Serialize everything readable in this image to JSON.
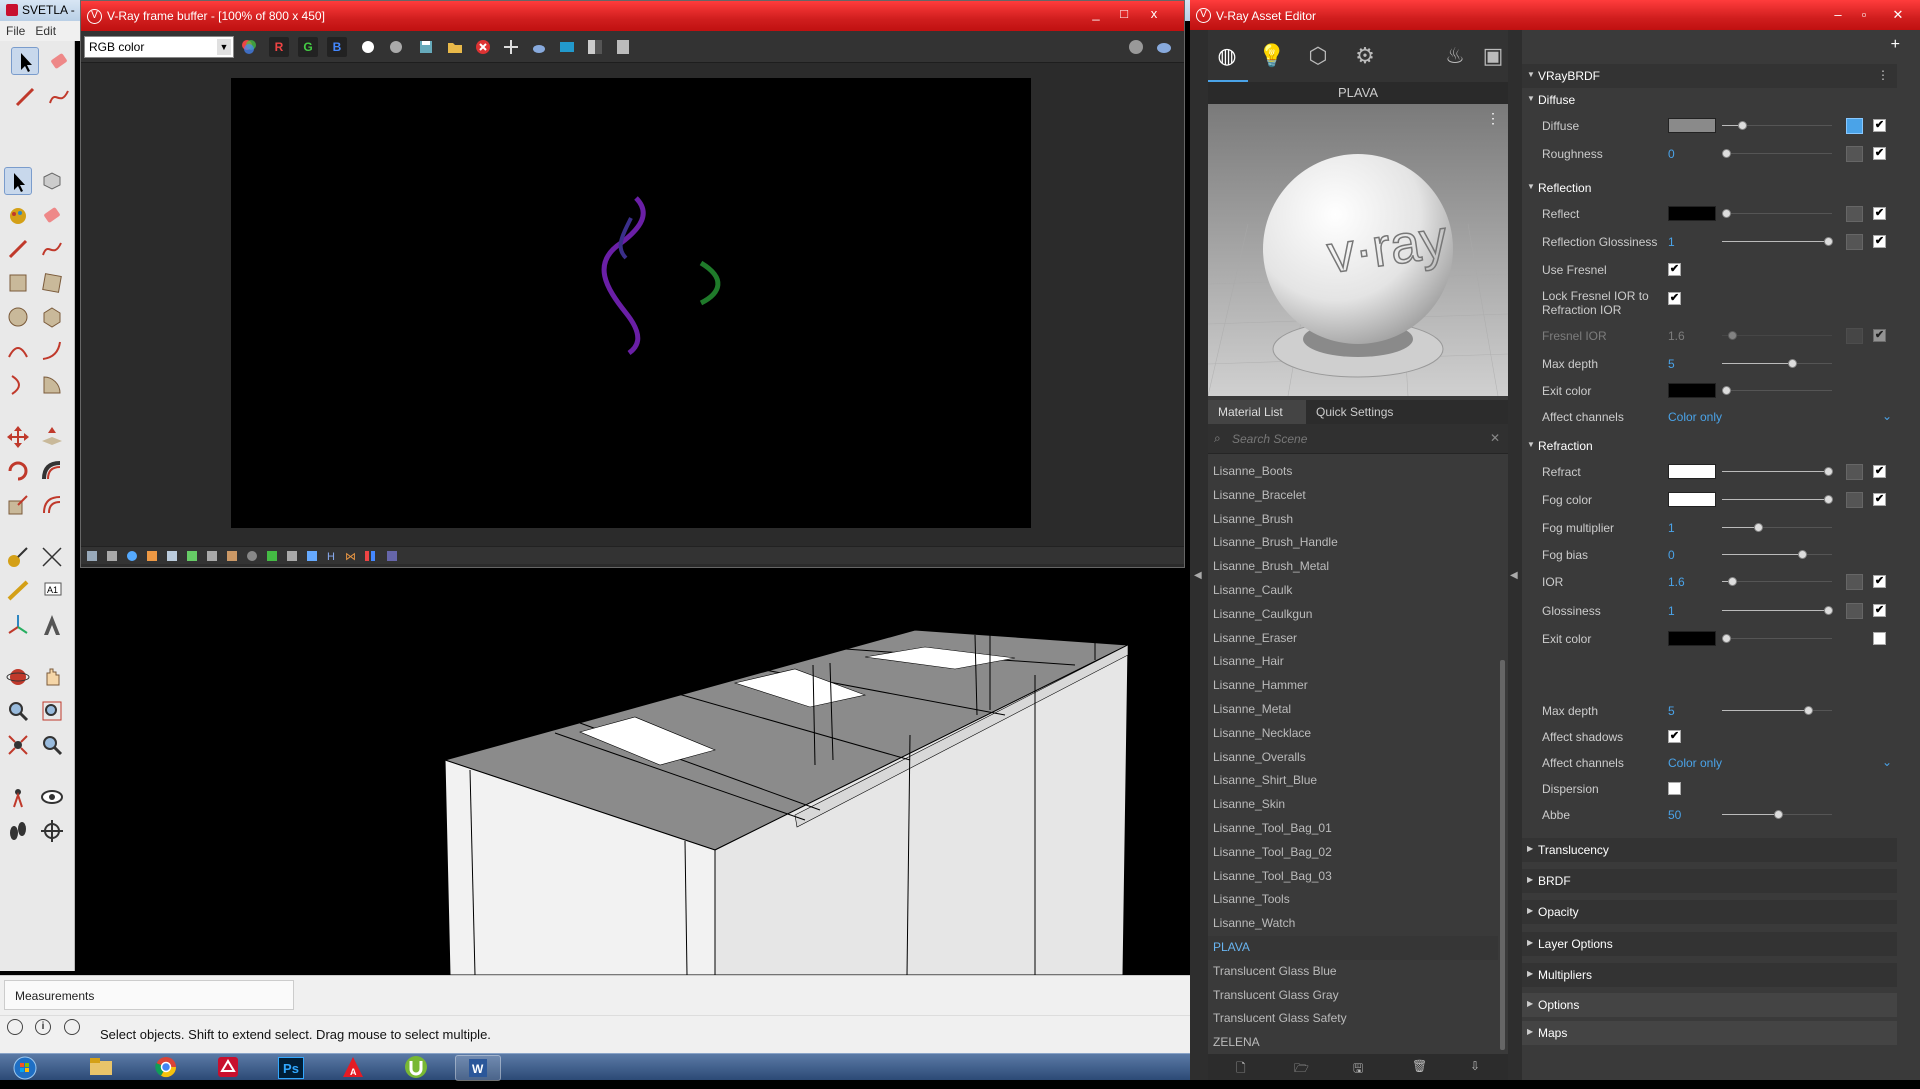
{
  "sketchup": {
    "title": "SVETLA -",
    "menu": [
      "File",
      "Edit"
    ],
    "measurements_label": "Measurements",
    "status_text": "Select objects. Shift to extend select. Drag mouse to select multiple."
  },
  "vfb": {
    "title": "V-Ray frame buffer - [100% of 800 x 450]",
    "channel": "RGB color",
    "channel_buttons": [
      "R",
      "G",
      "B"
    ],
    "window_buttons": [
      "_",
      "□",
      "x"
    ]
  },
  "asset_editor": {
    "title": "V-Ray Asset Editor",
    "material_name": "PLAVA",
    "preview_text": "v·ray",
    "tabs": [
      "Material List",
      "Quick Settings"
    ],
    "search_placeholder": "Search Scene",
    "materials": [
      "Lisanne_Boots",
      "Lisanne_Bracelet",
      "Lisanne_Brush",
      "Lisanne_Brush_Handle",
      "Lisanne_Brush_Metal",
      "Lisanne_Caulk",
      "Lisanne_Caulkgun",
      "Lisanne_Eraser",
      "Lisanne_Hair",
      "Lisanne_Hammer",
      "Lisanne_Metal",
      "Lisanne_Necklace",
      "Lisanne_Overalls",
      "Lisanne_Shirt_Blue",
      "Lisanne_Skin",
      "Lisanne_Tool_Bag_01",
      "Lisanne_Tool_Bag_02",
      "Lisanne_Tool_Bag_03",
      "Lisanne_Tools",
      "Lisanne_Watch",
      "PLAVA",
      "Translucent Glass Blue",
      "Translucent Glass Gray",
      "Translucent Glass Safety",
      "ZELENA"
    ],
    "selected_material": "PLAVA",
    "brdf_title": "VRayBRDF",
    "sections": {
      "diffuse": "Diffuse",
      "reflection": "Reflection",
      "refraction": "Refraction",
      "collapsed": [
        "Translucency",
        "BRDF",
        "Opacity",
        "Layer Options",
        "Multipliers",
        "Options",
        "Maps"
      ]
    },
    "diffuse": {
      "diffuse_label": "Diffuse",
      "diffuse_color": "#8a8a8a",
      "roughness_label": "Roughness",
      "roughness": "0"
    },
    "reflection": {
      "reflect_label": "Reflect",
      "reflect_color": "#000000",
      "gloss_label": "Reflection Glossiness",
      "gloss": "1",
      "fresnel_label": "Use Fresnel",
      "lock_label": "Lock Fresnel IOR to Refraction IOR",
      "fresnel_ior_label": "Fresnel IOR",
      "fresnel_ior": "1.6",
      "max_depth_label": "Max depth",
      "max_depth": "5",
      "exit_label": "Exit color",
      "affect_label": "Affect channels",
      "affect": "Color only"
    },
    "refraction": {
      "refract_label": "Refract",
      "fog_color_label": "Fog color",
      "fog_mult_label": "Fog multiplier",
      "fog_mult": "1",
      "fog_bias_label": "Fog bias",
      "fog_bias": "0",
      "ior_label": "IOR",
      "ior": "1.6",
      "gloss_label": "Glossiness",
      "gloss": "1",
      "exit_label": "Exit color",
      "max_depth_label": "Max depth",
      "max_depth": "5",
      "shadows_label": "Affect shadows",
      "affect_label": "Affect channels",
      "affect": "Color only",
      "dispersion_label": "Dispersion",
      "abbe_label": "Abbe",
      "abbe": "50"
    }
  },
  "taskbar": {
    "apps": [
      "start-orb",
      "explorer",
      "chrome",
      "sketchup",
      "photoshop",
      "autocad",
      "utorrent",
      "word"
    ],
    "ps_label": "Ps"
  },
  "colors": {
    "vray_red": "#d01e1e",
    "accent_blue": "#4aa3e8"
  }
}
